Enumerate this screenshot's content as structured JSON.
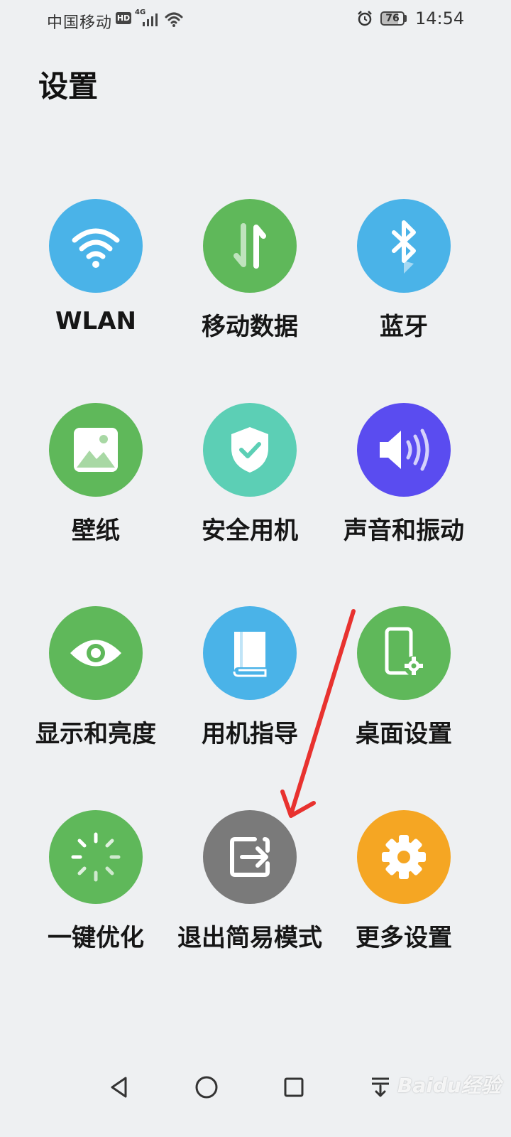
{
  "status_bar": {
    "carrier": "中国移动",
    "hd": "HD",
    "network": "4G",
    "battery": "76",
    "time": "14:54"
  },
  "page": {
    "title": "设置"
  },
  "tiles": [
    {
      "label": "WLAN",
      "icon": "wifi-icon",
      "color": "#4ab3e8"
    },
    {
      "label": "移动数据",
      "icon": "mobile-data-icon",
      "color": "#5fb85a"
    },
    {
      "label": "蓝牙",
      "icon": "bluetooth-icon",
      "color": "#4ab3e8"
    },
    {
      "label": "壁纸",
      "icon": "wallpaper-icon",
      "color": "#5fb85a"
    },
    {
      "label": "安全用机",
      "icon": "shield-icon",
      "color": "#5ccfb5"
    },
    {
      "label": "声音和振动",
      "icon": "sound-icon",
      "color": "#5a4cf0"
    },
    {
      "label": "显示和亮度",
      "icon": "eye-icon",
      "color": "#5fb85a"
    },
    {
      "label": "用机指导",
      "icon": "book-icon",
      "color": "#4ab3e8"
    },
    {
      "label": "桌面设置",
      "icon": "desktop-settings-icon",
      "color": "#5fb85a"
    },
    {
      "label": "一键优化",
      "icon": "optimize-icon",
      "color": "#5fb85a"
    },
    {
      "label": "退出简易模式",
      "icon": "exit-icon",
      "color": "#7a7a7a"
    },
    {
      "label": "更多设置",
      "icon": "gear-icon",
      "color": "#f5a623"
    }
  ],
  "annotation": {
    "color": "#e8322f"
  },
  "watermark": {
    "text": "Baidu经验"
  }
}
